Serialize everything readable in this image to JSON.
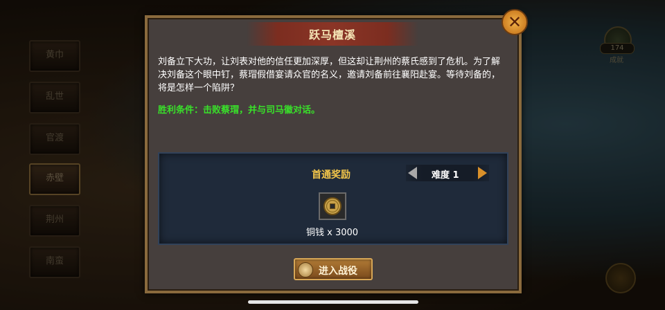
{
  "chapters": [
    {
      "label": "黄巾"
    },
    {
      "label": "乱世"
    },
    {
      "label": "官渡"
    },
    {
      "label": "赤壁"
    },
    {
      "label": "荆州"
    },
    {
      "label": "南蛮"
    }
  ],
  "achievement": {
    "count": "174",
    "label": "成就"
  },
  "dialog": {
    "title": "跃马檀溪",
    "close_symbol": "✕",
    "description": "刘备立下大功，让刘表对他的信任更加深厚，但这却让荆州的蔡氏感到了危机。为了解决刘备这个眼中钉，蔡瑁假借宴请众官的名义，邀请刘备前往襄阳赴宴。等待刘备的，将是怎样一个陷阱？",
    "victory_condition": "胜利条件：击败蔡瑁，并与司马徽对话。"
  },
  "reward": {
    "title": "首通奖励",
    "difficulty_label": "难度 1",
    "item_label": "铜钱 x 3000",
    "item_icon": "copper-coin-icon"
  },
  "enter_button": {
    "label": "进入战役",
    "icon": "battle-icon"
  },
  "colors": {
    "victory": "#39e02a",
    "reward_title": "#f2c54a",
    "dialog_bg": "#463f3d",
    "border_gold": "#8a6a3d"
  }
}
